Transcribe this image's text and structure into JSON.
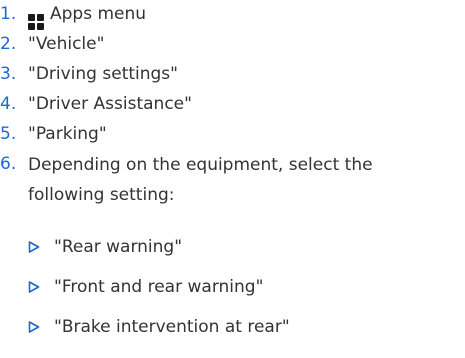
{
  "steps": [
    {
      "num": "1.",
      "text": "Apps menu",
      "icon": "apps-grid-icon"
    },
    {
      "num": "2.",
      "text": "\"Vehicle\""
    },
    {
      "num": "3.",
      "text": "\"Driving settings\""
    },
    {
      "num": "4.",
      "text": "\"Driver Assistance\""
    },
    {
      "num": "5.",
      "text": "\"Parking\""
    },
    {
      "num": "6.",
      "line1": "Depending on the equipment, select the",
      "line2": "following setting:"
    }
  ],
  "options": [
    "\"Rear warning\"",
    "\"Front and rear warning\"",
    "\"Brake intervention at rear\""
  ],
  "colors": {
    "accent": "#1c69d4",
    "text": "#333333"
  }
}
